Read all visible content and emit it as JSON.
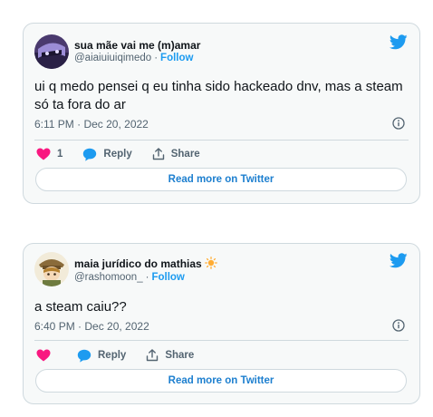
{
  "tweets": [
    {
      "author_name": "sua mãe vai me (m)amar",
      "handle": "@aiaiuiuiqimedo",
      "follow_label": "Follow",
      "text": "ui q medo pensei q eu tinha sido hackeado dnv, mas a steam só ta fora do ar",
      "timestamp": "6:11 PM · Dec 20, 2022",
      "like_count": "1",
      "reply_label": "Reply",
      "share_label": "Share",
      "read_more_label": "Read more on Twitter",
      "avatar_icon": "anime-avatar-icon"
    },
    {
      "author_name": "maia jurídico do mathias",
      "handle": "@rashomoon_",
      "follow_label": "Follow",
      "text": "a steam caiu??",
      "timestamp": "6:40 PM · Dec 20, 2022",
      "like_count": "",
      "reply_label": "Reply",
      "share_label": "Share",
      "read_more_label": "Read more on Twitter",
      "avatar_icon": "anime-avatar-icon"
    }
  ],
  "colors": {
    "twitter_blue": "#1d9bf0",
    "like_pink": "#f91880",
    "muted_text": "#536471",
    "card_background": "#f7f9f9"
  }
}
